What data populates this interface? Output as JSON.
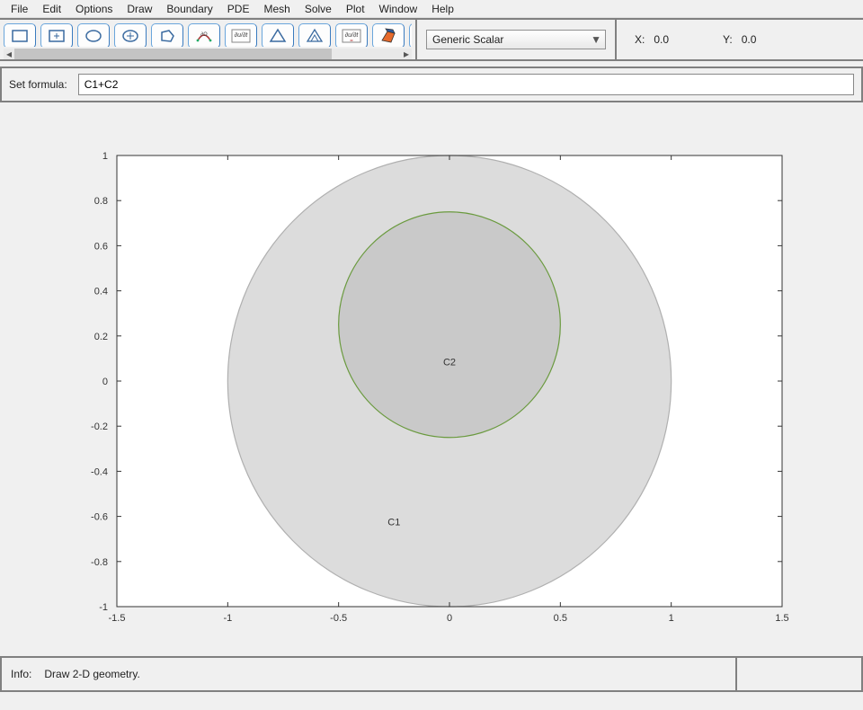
{
  "menu": {
    "items": [
      "File",
      "Edit",
      "Options",
      "Draw",
      "Boundary",
      "PDE",
      "Mesh",
      "Solve",
      "Plot",
      "Window",
      "Help"
    ]
  },
  "toolbar": {
    "icons": [
      "rectangle-icon",
      "rectangle-center-icon",
      "ellipse-icon",
      "ellipse-center-icon",
      "polygon-icon",
      "boundary-icon",
      "pde-spec-icon",
      "mesh-init-icon",
      "mesh-refine-icon",
      "solve-icon",
      "plot-3d-icon",
      "zoom-icon"
    ]
  },
  "mode_dropdown": {
    "selected": "Generic Scalar"
  },
  "coords": {
    "x_label": "X:",
    "x_value": "0.0",
    "y_label": "Y:",
    "y_value": "0.0"
  },
  "formula": {
    "label": "Set formula:",
    "value": "C1+C2"
  },
  "status": {
    "label": "Info:",
    "text": "Draw 2-D geometry."
  },
  "plot": {
    "x_range": [
      -1.5,
      1.5
    ],
    "y_range": [
      -1.0,
      1.0
    ],
    "x_ticks": [
      -1.5,
      -1,
      -0.5,
      0,
      0.5,
      1,
      1.5
    ],
    "y_ticks": [
      -1,
      -0.8,
      -0.6,
      -0.4,
      -0.2,
      0,
      0.2,
      0.4,
      0.6,
      0.8,
      1
    ],
    "shapes": [
      {
        "name": "C1",
        "type": "circle",
        "cx": 0,
        "cy": 0,
        "r": 1.0,
        "fill": "#dcdcdc",
        "stroke": "#b0b0b0",
        "label_xy": [
          -0.25,
          -0.64
        ]
      },
      {
        "name": "C2",
        "type": "circle",
        "cx": 0,
        "cy": 0.25,
        "r": 0.5,
        "fill": "#c9c9c9",
        "stroke": "#6a9a3e",
        "label_xy": [
          0,
          0.07
        ]
      }
    ]
  },
  "chart_data": {
    "type": "scatter",
    "title": "",
    "xlabel": "",
    "ylabel": "",
    "xlim": [
      -1.5,
      1.5
    ],
    "ylim": [
      -1.0,
      1.0
    ],
    "shapes": [
      {
        "label": "C1",
        "kind": "circle",
        "center": [
          0,
          0
        ],
        "radius": 1.0
      },
      {
        "label": "C2",
        "kind": "circle",
        "center": [
          0,
          0.25
        ],
        "radius": 0.5
      }
    ]
  }
}
